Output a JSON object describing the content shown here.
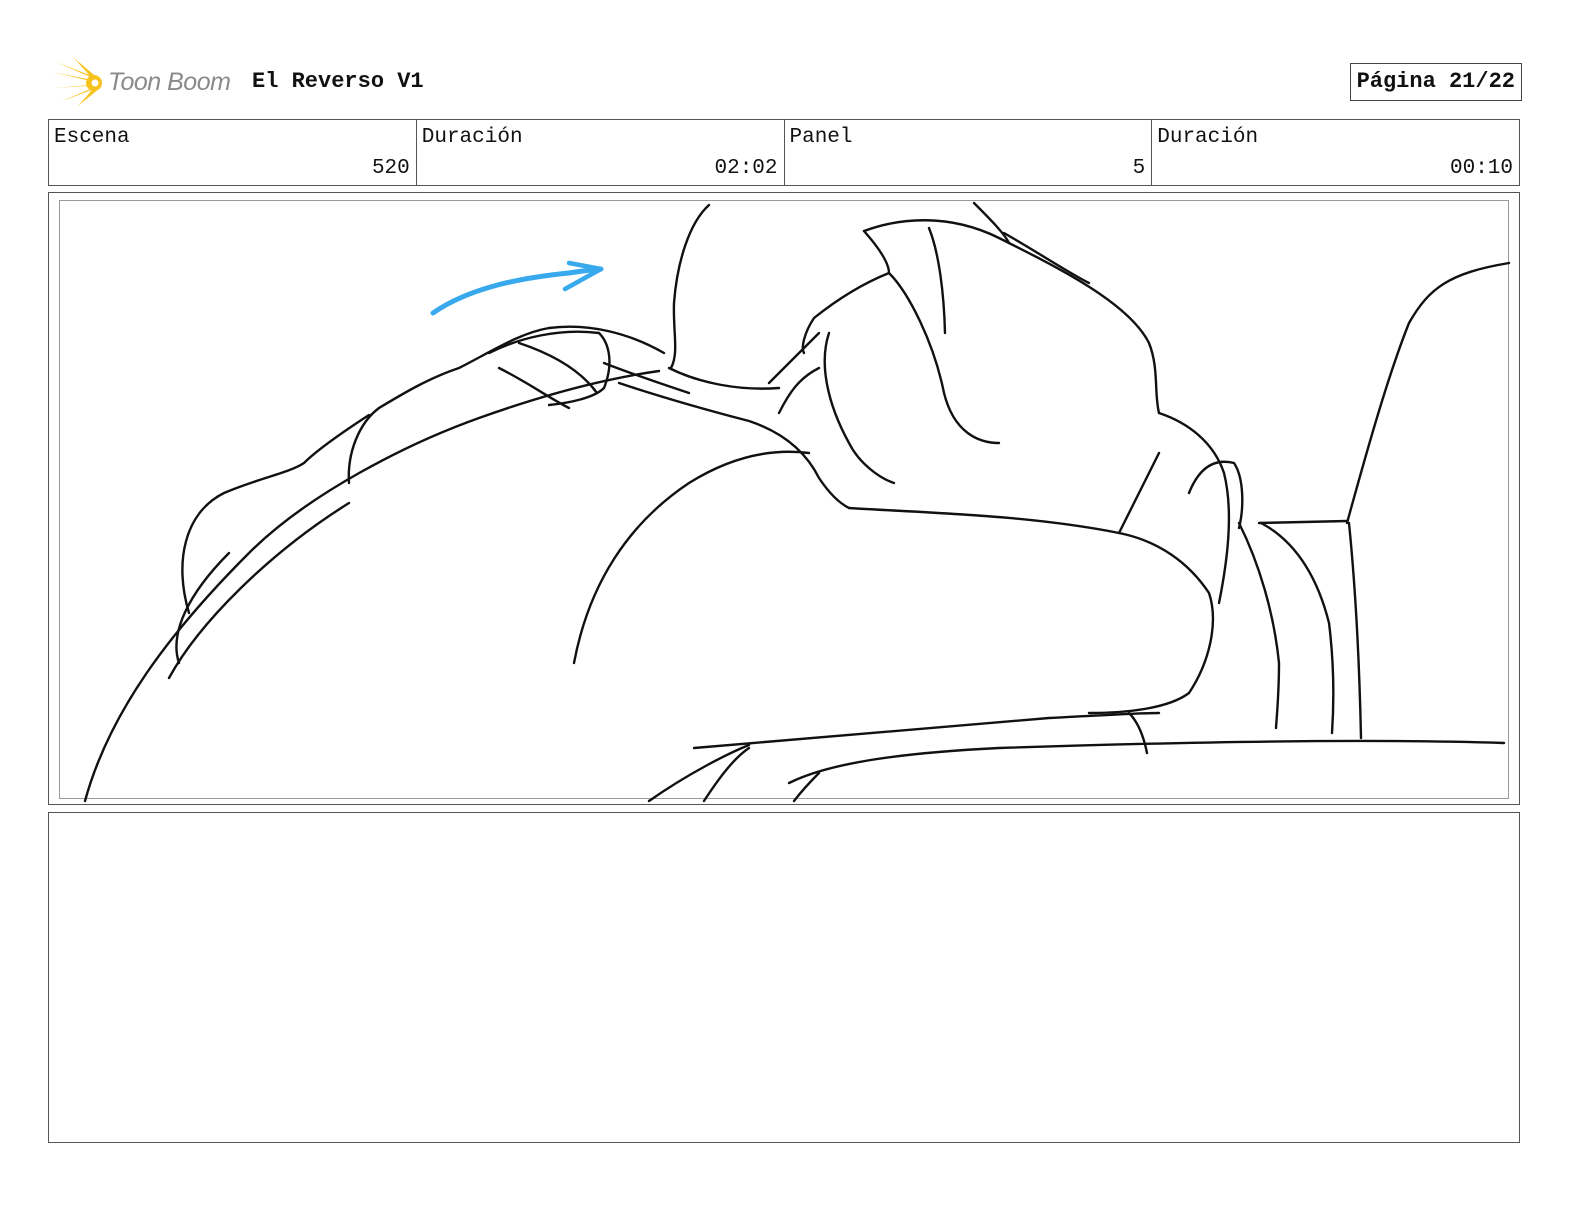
{
  "header": {
    "logo_text": "Toon Boom",
    "project_title": "El Reverso V1",
    "page_label": "Página 21/22"
  },
  "info": {
    "scene_label": "Escena",
    "scene_value": "520",
    "scene_duration_label": "Duración",
    "scene_duration_value": "02:02",
    "panel_label": "Panel",
    "panel_value": "5",
    "panel_duration_label": "Duración",
    "panel_duration_value": "00:10"
  },
  "colors": {
    "logo_yellow": "#f7c21b",
    "arrow_blue": "#38a9ec",
    "sketch_line": "#111111"
  },
  "icons": {
    "logo": "starburst-logo-icon",
    "motion_arrow": "motion-arrow-icon"
  }
}
